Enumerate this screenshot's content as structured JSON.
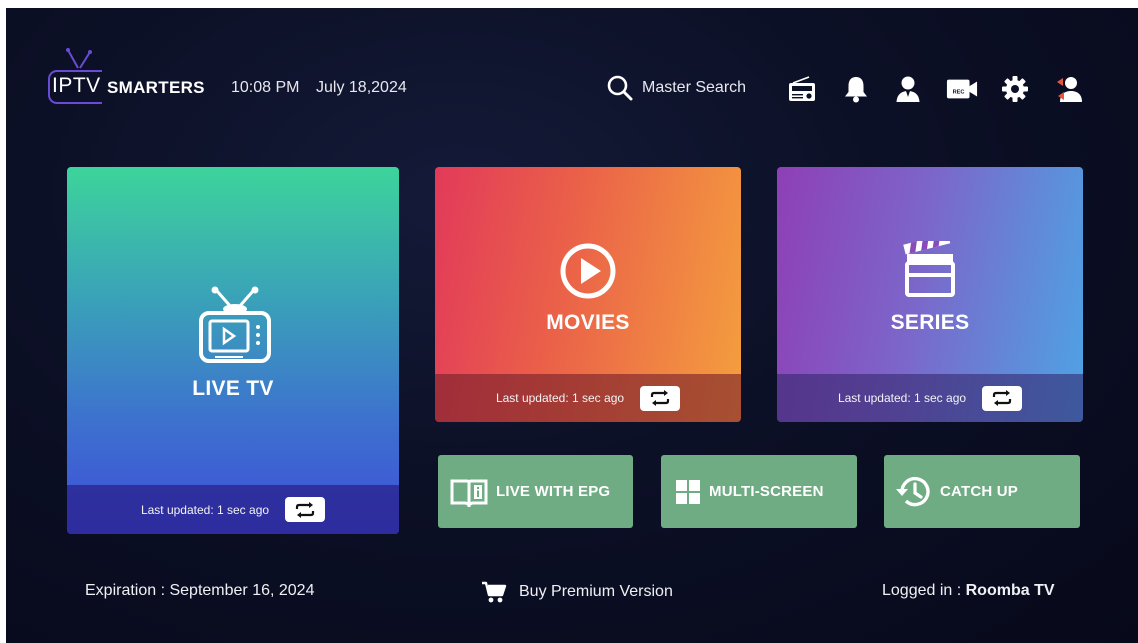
{
  "header": {
    "logo_left": "IPTV",
    "logo_right": "SMARTERS",
    "time": "10:08 PM",
    "date": "July 18,2024",
    "search_label": "Master Search",
    "icons": [
      "radio-icon",
      "bell-icon",
      "user-icon",
      "rec-camera-icon",
      "gear-icon",
      "switch-user-icon"
    ],
    "rec_text": "REC"
  },
  "tiles": {
    "live_tv": {
      "title": "LIVE TV",
      "updated": "Last updated: 1 sec ago"
    },
    "movies": {
      "title": "MOVIES",
      "updated": "Last updated: 1 sec ago"
    },
    "series": {
      "title": "SERIES",
      "updated": "Last updated: 1 sec ago"
    },
    "live_epg": {
      "label": "LIVE WITH EPG"
    },
    "multi_screen": {
      "label": "MULTI-SCREEN"
    },
    "catch_up": {
      "label": "CATCH UP"
    }
  },
  "footer": {
    "expiration": "Expiration : September 16, 2024",
    "buy_label": "Buy Premium Version",
    "logged_prefix": "Logged in : ",
    "logged_user": "Roomba TV"
  },
  "colors": {
    "background": "#0c1026",
    "small_tile": "#6fac84",
    "logo_accent": "#6a4bd6"
  }
}
